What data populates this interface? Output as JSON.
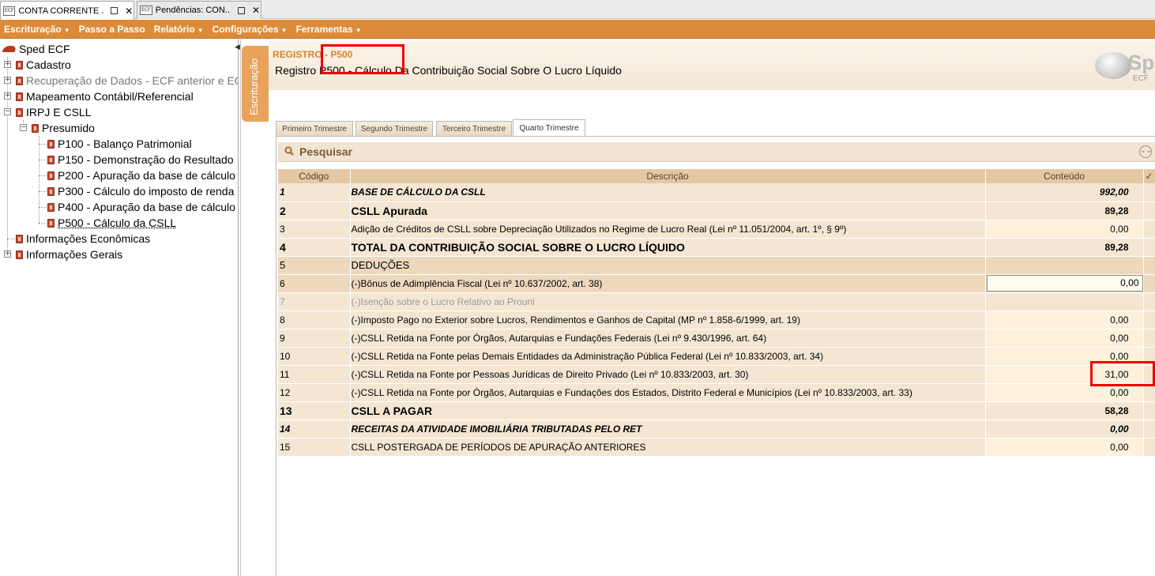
{
  "doc_tabs": [
    {
      "icon": "ECF",
      "label": "CONTA CORRENTE ...",
      "active": true
    },
    {
      "icon": "ECF",
      "label": "Pendências: CON...",
      "active": false
    }
  ],
  "menu": [
    {
      "label": "Escrituração",
      "dropdown": true
    },
    {
      "label": "Passo a Passo",
      "dropdown": false
    },
    {
      "label": "Relatório",
      "dropdown": true
    },
    {
      "label": "Configurações",
      "dropdown": true
    },
    {
      "label": "Ferramentas",
      "dropdown": true
    }
  ],
  "tree": {
    "root": "Sped ECF",
    "items": [
      {
        "label": "Cadastro"
      },
      {
        "label": "Recuperação de Dados - ECF anterior e EC"
      },
      {
        "label": "Mapeamento Contábil/Referencial"
      },
      {
        "label": "IRPJ E CSLL"
      },
      {
        "label": "Presumido"
      },
      {
        "label": "P100 - Balanço Patrimonial"
      },
      {
        "label": "P150 - Demonstração do Resultado"
      },
      {
        "label": "P200 - Apuração da base de cálculo"
      },
      {
        "label": "P300 - Cálculo do imposto de renda"
      },
      {
        "label": "P400 - Apuração da base de cálculo"
      },
      {
        "label": "P500 - Cálculo da CSLL"
      },
      {
        "label": "Informações Econômicas"
      },
      {
        "label": "Informações Gerais"
      }
    ]
  },
  "side_tab": "Escrituração",
  "header": {
    "code": "REGISTRO - P500",
    "title": "Registro P500 - Cálculo Da Contribuição Social Sobre O Lucro Líquido",
    "logo_text": "Sp",
    "logo_sub": "ECF"
  },
  "period_tabs": [
    {
      "label": "Primeiro Trimestre",
      "active": false
    },
    {
      "label": "Segundo Trimestre",
      "active": false
    },
    {
      "label": "Terceiro Trimestre",
      "active": false
    },
    {
      "label": "Quarto Trimestre",
      "active": true
    }
  ],
  "search": {
    "label": "Pesquisar"
  },
  "table": {
    "headers": {
      "code": "Código",
      "desc": "Descrição",
      "value": "Conteúdo",
      "check": "✓"
    },
    "rows": [
      {
        "code": "1",
        "desc": "BASE DE CÁLCULO DA CSLL",
        "value": "992,00",
        "style": "sum"
      },
      {
        "code": "2",
        "desc": "CSLL Apurada",
        "value": "89,28",
        "style": "big"
      },
      {
        "code": "3",
        "desc": "Adição de Créditos de CSLL sobre Depreciação Utilizados no Regime de Lucro Real (Lei nº 11.051/2004, art. 1º, § 9º)",
        "value": "0,00",
        "style": "edit"
      },
      {
        "code": "4",
        "desc": "TOTAL DA CONTRIBUIÇÃO SOCIAL SOBRE O LUCRO LÍQUIDO",
        "value": "89,28",
        "style": "big"
      },
      {
        "code": "5",
        "desc": "DEDUÇÕES",
        "value": "",
        "style": "group"
      },
      {
        "code": "6",
        "desc": "(-)Bônus de Adimplência Fiscal (Lei nº 10.637/2002, art. 38)",
        "value": "0,00",
        "style": "sel"
      },
      {
        "code": "7",
        "desc": "(-)Isenção sobre o Lucro Relativo ao Prouni",
        "value": "",
        "style": "dis"
      },
      {
        "code": "8",
        "desc": "(-)Imposto Pago no Exterior sobre Lucros, Rendimentos e Ganhos de Capital (MP nº 1.858-6/1999, art. 19)",
        "value": "0,00",
        "style": "edit"
      },
      {
        "code": "9",
        "desc": "(-)CSLL Retida na Fonte por Órgãos, Autarquias e Fundações Federais (Lei nº 9.430/1996, art. 64)",
        "value": "0,00",
        "style": "edit"
      },
      {
        "code": "10",
        "desc": "(-)CSLL Retida na Fonte pelas Demais Entidades da Administração Pública Federal (Lei nº 10.833/2003, art. 34)",
        "value": "0,00",
        "style": "edit"
      },
      {
        "code": "11",
        "desc": "(-)CSLL Retida na Fonte por Pessoas Jurídicas de Direito Privado (Lei nº 10.833/2003, art. 30)",
        "value": "31,00",
        "style": "edit"
      },
      {
        "code": "12",
        "desc": "(-)CSLL Retida na Fonte por Órgãos, Autarquias e Fundações dos Estados, Distrito Federal e Municípios (Lei nº 10.833/2003, art. 33)",
        "value": "0,00",
        "style": "edit"
      },
      {
        "code": "13",
        "desc": "CSLL A PAGAR",
        "value": "58,28",
        "style": "big"
      },
      {
        "code": "14",
        "desc": "RECEITAS DA ATIVIDADE IMOBILIÁRIA TRIBUTADAS PELO RET",
        "value": "0,00",
        "style": "sum"
      },
      {
        "code": "15",
        "desc": "CSLL POSTERGADA DE PERÍODOS DE APURAÇÃO ANTERIORES",
        "value": "0,00",
        "style": "edit"
      }
    ]
  },
  "colors": {
    "accent": "#dc8b39",
    "highlight": "#ee0000"
  }
}
